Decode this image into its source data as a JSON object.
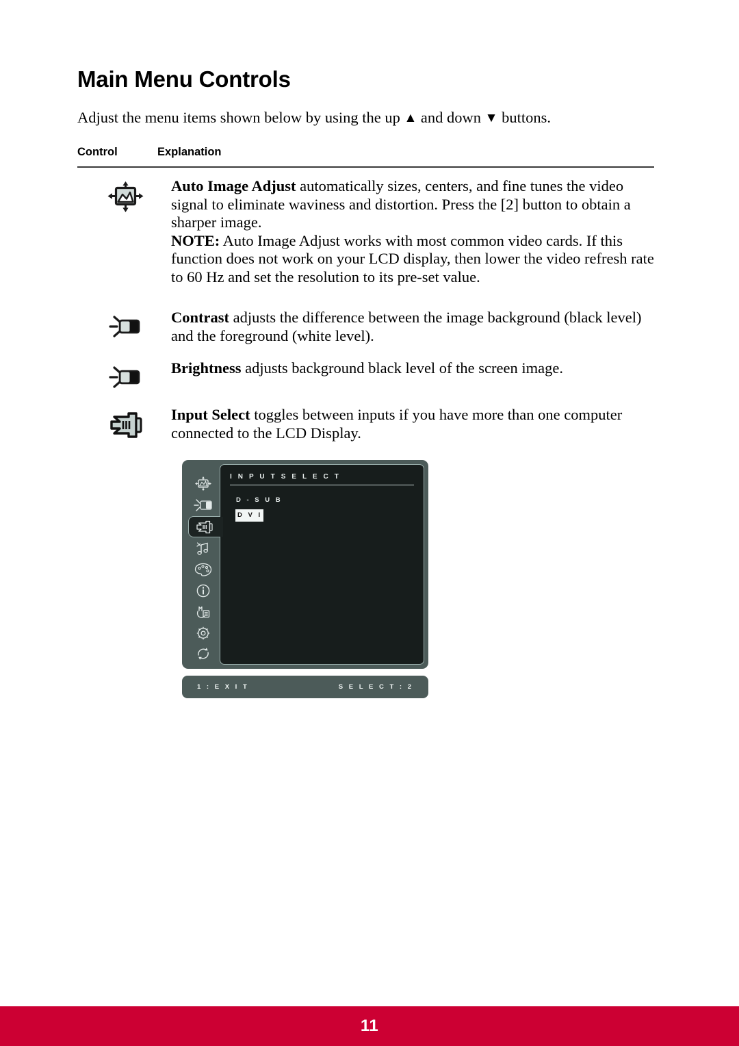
{
  "document": {
    "title": "Main Menu Controls",
    "intro_before": "Adjust the menu items shown below by using the up ",
    "intro_up_glyph": "▲",
    "intro_middle": " and down ",
    "intro_down_glyph": "▼",
    "intro_after": " buttons.",
    "page_number": "11",
    "footer_color": "#cc0033"
  },
  "table": {
    "headers": {
      "control": "Control",
      "explanation": "Explanation"
    },
    "rows": [
      {
        "icon": "auto-image-adjust-icon",
        "bold_lead": "Auto Image Adjust",
        "body": " automatically sizes, centers, and fine tunes the video signal to eliminate waviness and distortion. Press the [2] button to obtain a sharper image.",
        "note_lead": "NOTE:",
        "note_body": " Auto Image Adjust works with most common video cards. If this function does not work on your LCD display, then lower the video refresh rate to 60 Hz and set the resolution to its pre-set value."
      },
      {
        "icon": "contrast-icon",
        "bold_lead": "Contrast",
        "body": " adjusts the difference between the image background (black level) and the foreground (white level)."
      },
      {
        "icon": "brightness-icon",
        "bold_lead": "Brightness",
        "body": " adjusts background black level of the screen image."
      },
      {
        "icon": "input-select-icon",
        "bold_lead": "Input Select",
        "body": " toggles between inputs if you have more than one computer connected to the LCD Display."
      }
    ]
  },
  "osd": {
    "title": "I N P U T   S E L E C T",
    "options": [
      {
        "label": "D - S U B",
        "selected": false
      },
      {
        "label": "D V I",
        "selected": true
      }
    ],
    "footer_left": "1 : E X I T",
    "footer_right": "S E L E C T : 2",
    "sidebar_icons": [
      "osd-auto-image-adjust-icon",
      "osd-brightness-contrast-icon",
      "osd-input-select-icon",
      "osd-audio-icon",
      "osd-color-adjust-icon",
      "osd-information-icon",
      "osd-manual-image-adjust-icon",
      "osd-setup-menu-icon",
      "osd-memory-recall-icon"
    ],
    "colors": {
      "panel": "#4c5b59",
      "screen": "#171d1c",
      "text": "#e8eeed"
    }
  }
}
